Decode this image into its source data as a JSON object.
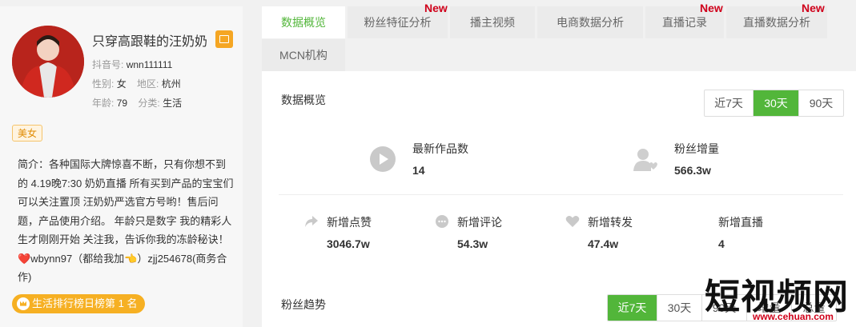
{
  "profile": {
    "name": "只穿高跟鞋的汪奶奶",
    "douyin_id_label": "抖音号:",
    "douyin_id": "wnn111111",
    "gender_label": "性别:",
    "gender": "女",
    "region_label": "地区:",
    "region": "杭州",
    "age_label": "年龄:",
    "age": "79",
    "category_label": "分类:",
    "category": "生活",
    "badge": "美女",
    "intro": "简介：各种国际大牌惊喜不断，只有你想不到的 4.19晚7:30 奶奶直播 所有买到产品的宝宝们可以关注置顶 汪奶奶严选官方号哟！售后问题，产品使用介绍。 年龄只是数字 我的精彩人生才刚刚开始 关注我，告诉你我的冻龄秘诀！ ❤️wbynn97（都给我加👈）zjj254678(商务合作)",
    "rank": "生活排行榜日榜第 1 名"
  },
  "tabs": [
    {
      "label": "数据概览",
      "active": true
    },
    {
      "label": "粉丝特征分析",
      "new": "New"
    },
    {
      "label": "播主视频"
    },
    {
      "label": "电商数据分析"
    },
    {
      "label": "直播记录",
      "new": "New"
    },
    {
      "label": "直播数据分析",
      "new": "New"
    },
    {
      "label": "MCN机构"
    }
  ],
  "overview": {
    "title": "数据概览",
    "ranges": [
      "近7天",
      "30天",
      "90天"
    ],
    "active_range": "30天",
    "latest_works_label": "最新作品数",
    "latest_works": "14",
    "fans_growth_label": "粉丝增量",
    "fans_growth": "566.3w",
    "likes_label": "新增点赞",
    "likes": "3046.7w",
    "comments_label": "新增评论",
    "comments": "54.3w",
    "shares_label": "新增转发",
    "shares": "47.4w",
    "lives_label": "新增直播",
    "lives": "4"
  },
  "trend": {
    "title": "粉丝趋势",
    "ranges": [
      "近7天",
      "30天",
      "90天",
      "增量",
      "总量"
    ],
    "active_range": "近7天"
  },
  "watermark": {
    "text": "短视频网",
    "url": "www.cehuan.com"
  },
  "colors": {
    "accent": "#52b63a",
    "new": "#d0021b",
    "rank": "#f6b023"
  }
}
